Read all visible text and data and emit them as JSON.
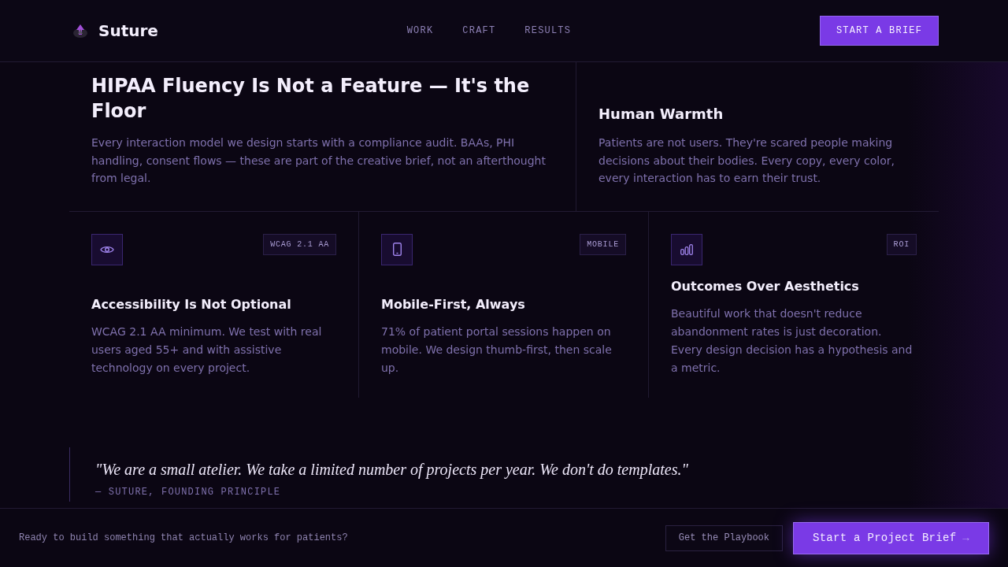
{
  "header": {
    "brand": "Suture",
    "nav": [
      {
        "label": "WORK"
      },
      {
        "label": "CRAFT"
      },
      {
        "label": "RESULTS"
      }
    ],
    "cta": "START A BRIEF"
  },
  "intro_features": [
    {
      "kind": "lead",
      "title": "HIPAA Fluency Is Not a Feature — It's the Floor",
      "body": "Every interaction model we design starts with a compliance audit. BAAs, PHI handling, consent flows — these are part of the creative brief, not an afterthought from legal."
    },
    {
      "kind": "standard",
      "title": "Human Warmth",
      "body": "Patients are not users. They're scared people making decisions about their bodies. Every copy, every color, every interaction has to earn their trust."
    }
  ],
  "cards": [
    {
      "badge": "WCAG 2.1 AA",
      "title": "Accessibility Is Not Optional",
      "body": "WCAG 2.1 AA minimum. We test with real users aged 55+ and with assistive technology on every project."
    },
    {
      "badge": "MOBILE",
      "title": "Mobile-First, Always",
      "body": "71% of patient portal sessions happen on mobile. We design thumb-first, then scale up."
    },
    {
      "badge": "ROI",
      "title": "Outcomes Over Aesthetics",
      "body": "Beautiful work that doesn't reduce abandonment rates is just decoration. Every design decision has a hypothesis and a metric."
    }
  ],
  "quote": {
    "text": "\"We are a small atelier. We take a limited number of projects per year. We don't do templates.\"",
    "attribution": "— SUTURE, FOUNDING PRINCIPLE"
  },
  "cta_bar": {
    "prompt": "Ready to build something that actually works for patients?",
    "buttons": [
      {
        "kind": "secondary",
        "label": "Get the Playbook"
      },
      {
        "kind": "primary",
        "label": "Start a Project Brief",
        "arrow": "→"
      }
    ]
  }
}
